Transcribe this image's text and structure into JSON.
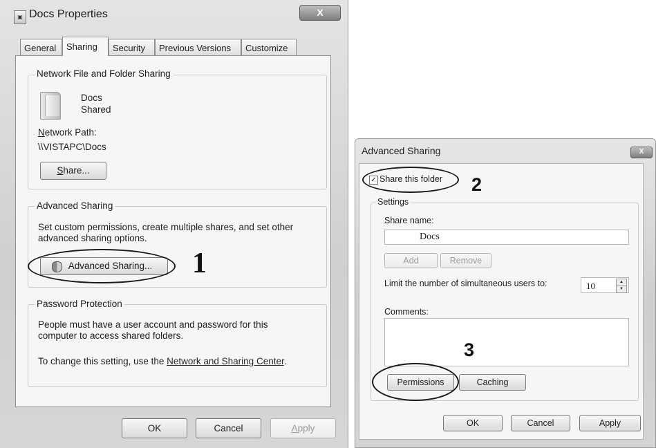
{
  "properties": {
    "title": "Docs Properties",
    "close_label": "X",
    "tabs": [
      "General",
      "Sharing",
      "Security",
      "Previous Versions",
      "Customize"
    ],
    "network_group": {
      "label": "Network File and Folder Sharing",
      "folder_name": "Docs",
      "folder_status": "Shared",
      "path_label": "Network Path:",
      "path_value": "\\\\VISTAPC\\Docs",
      "share_button": "Share..."
    },
    "advanced_group": {
      "label": "Advanced Sharing",
      "description_line1": "Set custom permissions, create multiple shares, and set other",
      "description_line2": "advanced sharing options.",
      "button": "Advanced Sharing..."
    },
    "password_group": {
      "label": "Password Protection",
      "line1": "People must have a user account and password for this",
      "line2": "computer to access shared folders.",
      "change_prefix": "To change this setting, use the ",
      "link": "Network and Sharing Center",
      "change_suffix": "."
    },
    "buttons": {
      "ok": "OK",
      "cancel": "Cancel",
      "apply": "Apply"
    }
  },
  "advanced_sharing": {
    "title": "Advanced Sharing",
    "close_label": "X",
    "share_checkbox_label": "Share this folder",
    "share_checked": true,
    "settings_label": "Settings",
    "share_name_label": "Share name:",
    "share_name_value": "Docs",
    "add_button": "Add",
    "remove_button": "Remove",
    "limit_label": "Limit the number of simultaneous users to:",
    "limit_value": "10",
    "comments_label": "Comments:",
    "comments_value": "",
    "permissions_button": "Permissions",
    "caching_button": "Caching",
    "buttons": {
      "ok": "OK",
      "cancel": "Cancel",
      "apply": "Apply"
    }
  },
  "annotations": {
    "step1": "1",
    "step2": "2",
    "step3": "3"
  }
}
